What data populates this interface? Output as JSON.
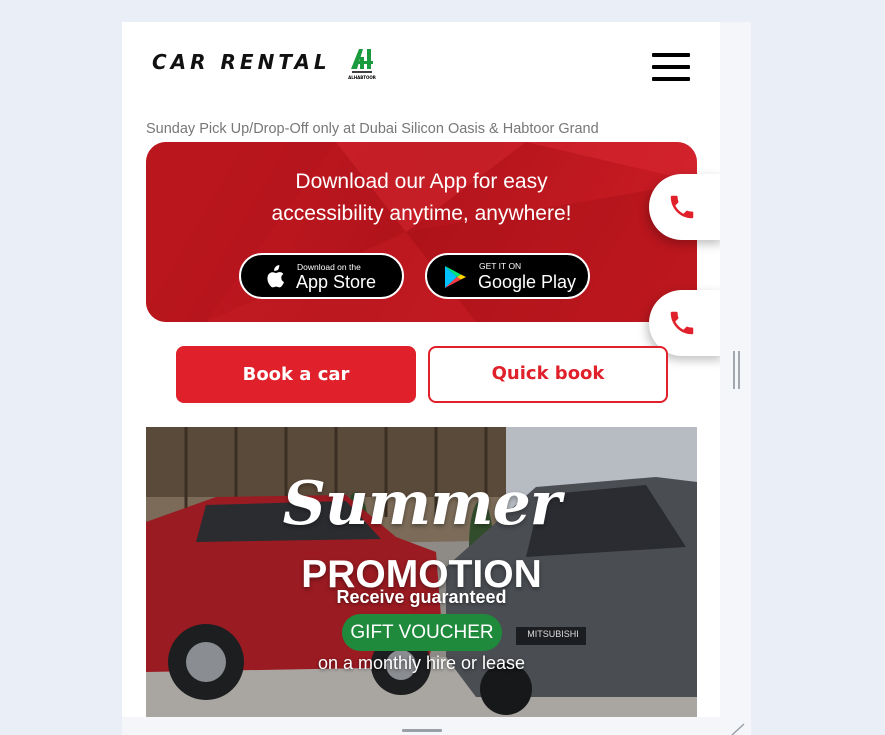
{
  "header": {
    "logo_text": "CAR RENTAL",
    "partner_logo": {
      "name": "ALHABTOOR",
      "icon": "habtoor-logo"
    },
    "menu_icon": "hamburger-menu-icon"
  },
  "notice": "Sunday Pick Up/Drop-Off only at Dubai Silicon Oasis & Habtoor Grand",
  "app_promo": {
    "heading_line1": "Download our App for easy",
    "heading_line2": "accessibility anytime, anywhere!",
    "app_store": {
      "small": "Download on the",
      "big": "App Store"
    },
    "google_play": {
      "small": "GET IT ON",
      "big": "Google Play"
    }
  },
  "actions": {
    "book_label": "Book a car",
    "quick_label": "Quick book"
  },
  "banner": {
    "title_script": "Summer",
    "title_block": "PROMOTION",
    "line1": "Receive guaranteed",
    "voucher": "GIFT VOUCHER",
    "line2": "on a monthly hire or lease",
    "plate": "MITSUBISHI"
  },
  "call_icon": "phone-icon",
  "colors": {
    "brand_red": "#e0202a",
    "voucher_green": "#1f8a3c",
    "logo_green": "#1a9c3e"
  }
}
